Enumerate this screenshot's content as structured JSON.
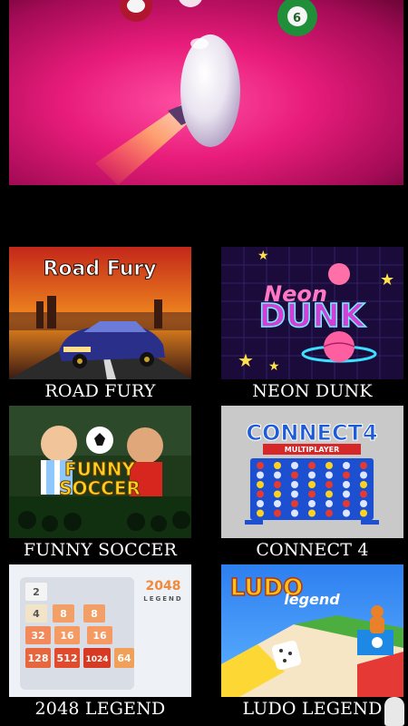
{
  "featured": {
    "name": "pool-game-banner"
  },
  "games": [
    {
      "title": "ROAD FURY",
      "art_title": "Road Fury"
    },
    {
      "title": "NEON DUNK",
      "art_title_1": "Neon",
      "art_title_2": "DUNK"
    },
    {
      "title": "FUNNY SOCCER",
      "art_title_1": "FUNNY",
      "art_title_2": "SOCCER"
    },
    {
      "title": "CONNECT 4",
      "art_title": "CONNECT4",
      "art_subtitle": "MULTIPLAYER"
    },
    {
      "title": "2048 LEGEND",
      "art_logo": "2048",
      "art_logo_sub": "LEGEND",
      "tiles": [
        "2",
        "4",
        "8",
        "8",
        "32",
        "16",
        "16",
        "128",
        "512",
        "1024",
        "64"
      ]
    },
    {
      "title": "LUDO LEGEND",
      "art_title_1": "LUDO",
      "art_title_2": "legend"
    }
  ],
  "colors": {
    "background": "#000000",
    "label_text": "#ffffff",
    "hero_pink": "#e81c7a"
  }
}
